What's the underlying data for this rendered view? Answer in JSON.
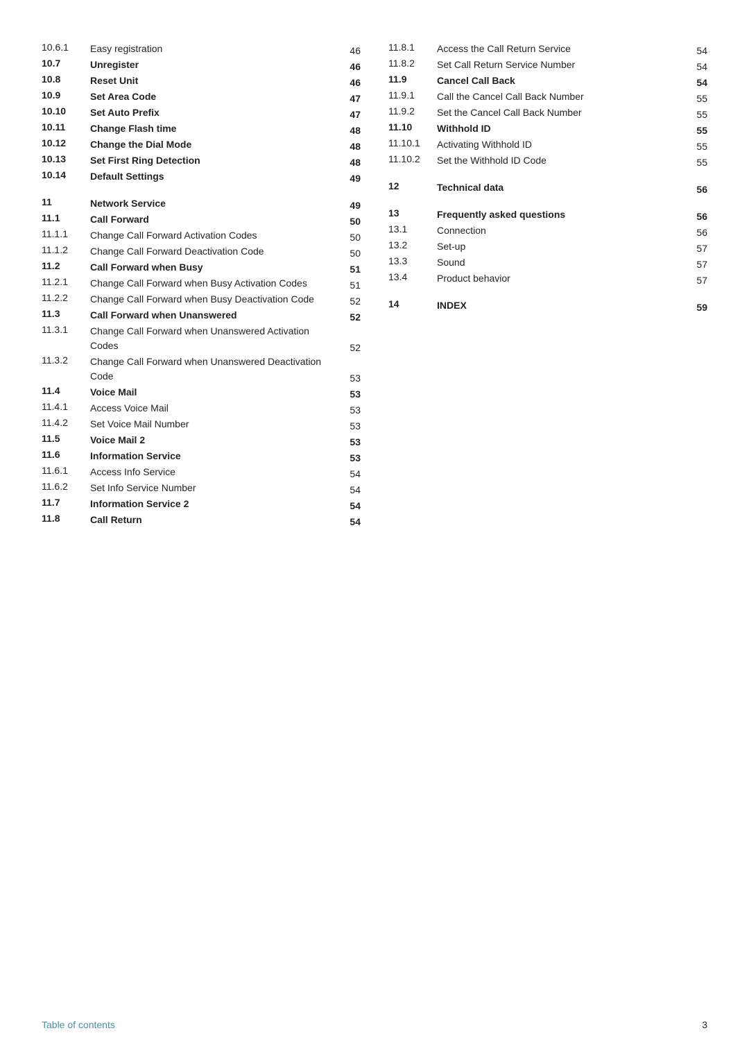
{
  "footer": {
    "left": "Table of contents",
    "right": "3"
  },
  "col1": {
    "entries": [
      {
        "num": "10.6.1",
        "label": "Easy registration",
        "page": "46",
        "bold": false,
        "multiline": false
      },
      {
        "num": "10.7",
        "label": "Unregister",
        "page": "46",
        "bold": true,
        "multiline": false
      },
      {
        "num": "10.8",
        "label": "Reset Unit",
        "page": "46",
        "bold": true,
        "multiline": false
      },
      {
        "num": "10.9",
        "label": "Set Area Code",
        "page": "47",
        "bold": true,
        "multiline": false
      },
      {
        "num": "10.10",
        "label": "Set Auto Prefix",
        "page": "47",
        "bold": true,
        "multiline": false
      },
      {
        "num": "10.11",
        "label": "Change Flash time",
        "page": "48",
        "bold": true,
        "multiline": false
      },
      {
        "num": "10.12",
        "label": "Change the Dial Mode",
        "page": "48",
        "bold": true,
        "multiline": false
      },
      {
        "num": "10.13",
        "label": "Set First Ring Detection",
        "page": "48",
        "bold": true,
        "multiline": false
      },
      {
        "num": "10.14",
        "label": "Default Settings",
        "page": "49",
        "bold": true,
        "multiline": false
      },
      {
        "spacer": true
      },
      {
        "num": "11",
        "label": "Network Service",
        "page": "49",
        "bold": true,
        "multiline": false
      },
      {
        "num": "11.1",
        "label": "Call Forward",
        "page": "50",
        "bold": true,
        "multiline": false
      },
      {
        "num": "11.1.1",
        "label": "Change Call Forward Activation Codes",
        "page": "50",
        "bold": false,
        "multiline": true
      },
      {
        "num": "11.1.2",
        "label": "Change Call Forward Deactivation Code",
        "page": "50",
        "bold": false,
        "multiline": true
      },
      {
        "num": "11.2",
        "label": "Call Forward when Busy",
        "page": "51",
        "bold": true,
        "multiline": false
      },
      {
        "num": "11.2.1",
        "label": "Change Call Forward when Busy Activation Codes",
        "page": "51",
        "bold": false,
        "multiline": true
      },
      {
        "num": "11.2.2",
        "label": "Change Call Forward when Busy Deactivation Code",
        "page": "52",
        "bold": false,
        "multiline": true
      },
      {
        "num": "11.3",
        "label": "Call Forward when Unanswered",
        "page": "52",
        "bold": true,
        "multiline": true
      },
      {
        "num": "11.3.1",
        "label": "Change Call Forward when Unanswered Activation Codes",
        "page": "52",
        "bold": false,
        "multiline": true
      },
      {
        "num": "11.3.2",
        "label": "Change Call Forward when Unanswered Deactivation Code",
        "page": "53",
        "bold": false,
        "multiline": true
      },
      {
        "num": "11.4",
        "label": "Voice Mail",
        "page": "53",
        "bold": true,
        "multiline": false
      },
      {
        "num": "11.4.1",
        "label": "Access Voice Mail",
        "page": "53",
        "bold": false,
        "multiline": false
      },
      {
        "num": "11.4.2",
        "label": "Set Voice Mail Number",
        "page": "53",
        "bold": false,
        "multiline": false
      },
      {
        "num": "11.5",
        "label": "Voice Mail 2",
        "page": "53",
        "bold": true,
        "multiline": false
      },
      {
        "num": "11.6",
        "label": "Information Service",
        "page": "53",
        "bold": true,
        "multiline": false
      },
      {
        "num": "11.6.1",
        "label": "Access Info Service",
        "page": "54",
        "bold": false,
        "multiline": false
      },
      {
        "num": "11.6.2",
        "label": "Set Info Service Number",
        "page": "54",
        "bold": false,
        "multiline": false
      },
      {
        "num": "11.7",
        "label": "Information Service 2",
        "page": "54",
        "bold": true,
        "multiline": false
      },
      {
        "num": "11.8",
        "label": "Call Return",
        "page": "54",
        "bold": true,
        "multiline": false
      }
    ]
  },
  "col2": {
    "entries": [
      {
        "num": "11.8.1",
        "label": "Access the Call Return Service",
        "page": "54",
        "bold": false,
        "multiline": true
      },
      {
        "num": "11.8.2",
        "label": "Set Call Return Service Number",
        "page": "54",
        "bold": false,
        "multiline": true
      },
      {
        "num": "11.9",
        "label": "Cancel Call Back",
        "page": "54",
        "bold": true,
        "multiline": false
      },
      {
        "num": "11.9.1",
        "label": "Call the Cancel Call Back Number",
        "page": "55",
        "bold": false,
        "multiline": true
      },
      {
        "num": "11.9.2",
        "label": "Set the Cancel Call Back Number",
        "page": "55",
        "bold": false,
        "multiline": true
      },
      {
        "num": "11.10",
        "label": "Withhold ID",
        "page": "55",
        "bold": true,
        "multiline": false
      },
      {
        "num": "11.10.1",
        "label": "Activating Withhold ID",
        "page": "55",
        "bold": false,
        "multiline": false
      },
      {
        "num": "11.10.2",
        "label": "Set the Withhold ID Code",
        "page": "55",
        "bold": false,
        "multiline": false
      },
      {
        "spacer": true
      },
      {
        "num": "12",
        "label": "Technical data",
        "page": "56",
        "bold": true,
        "multiline": false
      },
      {
        "spacer": true
      },
      {
        "num": "13",
        "label": "Frequently asked questions",
        "page": "56",
        "bold": true,
        "multiline": true
      },
      {
        "num": "13.1",
        "label": "Connection",
        "page": "56",
        "bold": false,
        "multiline": false
      },
      {
        "num": "13.2",
        "label": "Set-up",
        "page": "57",
        "bold": false,
        "multiline": false
      },
      {
        "num": "13.3",
        "label": "Sound",
        "page": "57",
        "bold": false,
        "multiline": false
      },
      {
        "num": "13.4",
        "label": "Product behavior",
        "page": "57",
        "bold": false,
        "multiline": false
      },
      {
        "spacer": true
      },
      {
        "num": "14",
        "label": "INDEX",
        "page": "59",
        "bold": true,
        "multiline": false
      }
    ]
  }
}
